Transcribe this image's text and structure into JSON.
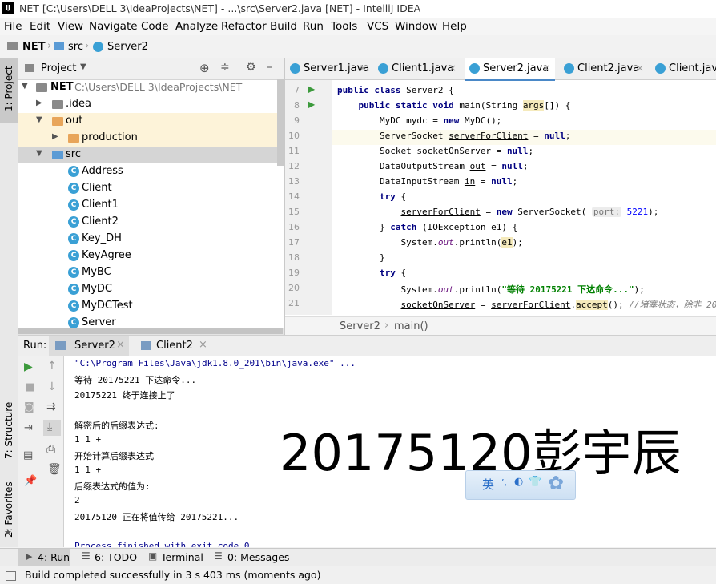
{
  "window": {
    "title": "NET [C:\\Users\\DELL 3\\IdeaProjects\\NET] - ...\\src\\Server2.java [NET] - IntelliJ IDEA",
    "logo": "IJ"
  },
  "menu": [
    "File",
    "Edit",
    "View",
    "Navigate",
    "Code",
    "Analyze",
    "Refactor",
    "Build",
    "Run",
    "Tools",
    "VCS",
    "Window",
    "Help"
  ],
  "breadcrumb": [
    "NET",
    "src",
    "Server2"
  ],
  "sidebar": {
    "project_label": "1: Project",
    "structure_label": "7: Structure",
    "favorites_label": "2: Favorites"
  },
  "project": {
    "title": "Project",
    "tree": [
      {
        "label": "NET",
        "extra": "C:\\Users\\DELL 3\\IdeaProjects\\NET",
        "kind": "folder-root"
      },
      {
        "label": ".idea",
        "kind": "folder"
      },
      {
        "label": "out",
        "kind": "folder-orange"
      },
      {
        "label": "production",
        "kind": "folder-orange"
      },
      {
        "label": "src",
        "kind": "folder-blue"
      },
      {
        "label": "Address",
        "kind": "class"
      },
      {
        "label": "Client",
        "kind": "class"
      },
      {
        "label": "Client1",
        "kind": "class"
      },
      {
        "label": "Client2",
        "kind": "class"
      },
      {
        "label": "Key_DH",
        "kind": "class"
      },
      {
        "label": "KeyAgree",
        "kind": "class"
      },
      {
        "label": "MyBC",
        "kind": "class"
      },
      {
        "label": "MyDC",
        "kind": "class"
      },
      {
        "label": "MyDCTest",
        "kind": "class"
      },
      {
        "label": "Server",
        "kind": "class"
      }
    ]
  },
  "editor": {
    "tabs": [
      "Server1.java",
      "Client1.java",
      "Server2.java",
      "Client2.java",
      "Client.java"
    ],
    "active_tab": "Server2.java",
    "line_numbers": [
      "7",
      "8",
      "9",
      "10",
      "11",
      "12",
      "13",
      "14",
      "15",
      "16",
      "17",
      "18",
      "19",
      "20",
      "21"
    ],
    "breadcrumb": [
      "Server2",
      "main()"
    ],
    "hint_port": "port:"
  },
  "run": {
    "label": "Run:",
    "tabs": [
      "Server2",
      "Client2"
    ],
    "console": [
      "\"C:\\Program Files\\Java\\jdk1.8.0_201\\bin\\java.exe\" ...",
      "等待 20175221 下达命令...",
      "20175221 终于连接上了",
      "",
      "解密后的后缀表达式:",
      "1 1 +",
      "开始计算后缀表达式",
      "1 1 +",
      "后缀表达式的值为:",
      "2",
      "20175120 正在将值传给 20175221...",
      "",
      "Process finished with exit code 0"
    ]
  },
  "bottom_tabs": [
    "4: Run",
    "6: TODO",
    "Terminal",
    "0: Messages"
  ],
  "status": "Build completed successfully in 3 s 403 ms (moments ago)",
  "overlay": {
    "watermark": "20175120彭宇辰",
    "ime": "英"
  }
}
